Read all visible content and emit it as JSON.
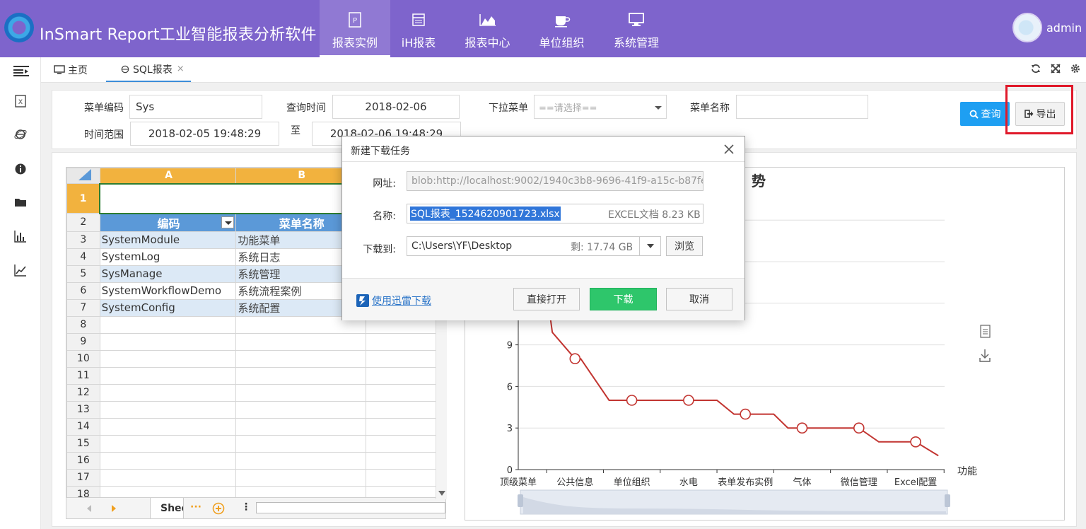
{
  "header": {
    "brand": "InSmart Report工业智能报表分析软件",
    "nav": [
      {
        "label": "报表实例",
        "icon": "report-file-icon"
      },
      {
        "label": "iH报表",
        "icon": "table-icon"
      },
      {
        "label": "报表中心",
        "icon": "area-chart-icon"
      },
      {
        "label": "单位组织",
        "icon": "cup-icon"
      },
      {
        "label": "系统管理",
        "icon": "monitor-icon"
      }
    ],
    "user": "admin"
  },
  "tabs": {
    "home": "主页",
    "sql": "SQL报表",
    "close": "×"
  },
  "filters": {
    "menu_code_label": "菜单编码",
    "menu_code_value": "Sys",
    "query_time_label": "查询时间",
    "query_time_value": "2018-02-06",
    "dropdown_label": "下拉菜单",
    "dropdown_placeholder": "==请选择==",
    "menu_name_label": "菜单名称",
    "menu_name_value": "",
    "time_range_label": "时间范围",
    "time_range_start": "2018-02-05 19:48:29",
    "to_label": "至",
    "time_range_end": "2018-02-06 19:48:29",
    "query_button": "查询",
    "export_button": "导出"
  },
  "sheet": {
    "col_a": "A",
    "col_b": "B",
    "header_code": "编码",
    "header_name": "菜单名称",
    "rows": [
      {
        "num": "3",
        "code": "SystemModule",
        "name": "功能菜单"
      },
      {
        "num": "4",
        "code": "SystemLog",
        "name": "系统日志"
      },
      {
        "num": "5",
        "code": "SysManage",
        "name": "系统管理"
      },
      {
        "num": "6",
        "code": "SystemWorkflowDemo",
        "name": "系统流程案例"
      },
      {
        "num": "7",
        "code": "SystemConfig",
        "name": "系统配置"
      }
    ],
    "empty_rows": [
      "8",
      "9",
      "10",
      "11",
      "12",
      "13",
      "14",
      "15",
      "16",
      "17",
      "18"
    ],
    "row1": "1",
    "row2": "2",
    "sheet_tab": "Shee",
    "more": "···",
    "menu": "⋮"
  },
  "chart_data": {
    "type": "line",
    "title": "势",
    "categories": [
      "顶级菜单",
      "公共信息",
      "单位组织",
      "水电",
      "表单发布实例",
      "气体",
      "微信管理",
      "Excel配置"
    ],
    "legend_tail": "功能",
    "yticks": [
      "0",
      "3",
      "6",
      "9"
    ],
    "ylim": [
      0,
      12
    ],
    "points": [
      {
        "x": 0.6,
        "y": 9.9,
        "marker": false
      },
      {
        "x": 1.0,
        "y": 8,
        "marker": true
      },
      {
        "x": 1.1,
        "y": 8,
        "marker": false
      },
      {
        "x": 1.6,
        "y": 5,
        "marker": false
      },
      {
        "x": 2.0,
        "y": 5,
        "marker": true
      },
      {
        "x": 3.0,
        "y": 5,
        "marker": true
      },
      {
        "x": 3.5,
        "y": 5,
        "marker": false
      },
      {
        "x": 3.8,
        "y": 4,
        "marker": false
      },
      {
        "x": 4.0,
        "y": 4,
        "marker": true
      },
      {
        "x": 4.5,
        "y": 4,
        "marker": false
      },
      {
        "x": 4.75,
        "y": 3,
        "marker": false
      },
      {
        "x": 5.0,
        "y": 3,
        "marker": true
      },
      {
        "x": 6.0,
        "y": 3,
        "marker": true
      },
      {
        "x": 6.35,
        "y": 2,
        "marker": false
      },
      {
        "x": 7.0,
        "y": 2,
        "marker": true
      },
      {
        "x": 7.4,
        "y": 1,
        "marker": false
      }
    ],
    "line_color": "#c23531"
  },
  "dialog": {
    "title": "新建下载任务",
    "url_label": "网址:",
    "url_value": "blob:http://localhost:9002/1940c3b8-9696-41f9-a15c-b87fe",
    "name_label": "名称:",
    "name_value": "SQL报表_1524620901723.xlsx",
    "file_type": "EXCEL文档 8.23 KB",
    "save_label": "下载到:",
    "save_path": "C:\\Users\\YF\\Desktop",
    "free_space": "剩: 17.74 GB",
    "browse": "浏览",
    "xunlei": "使用迅雷下载",
    "open": "直接打开",
    "download": "下载",
    "cancel": "取消"
  }
}
